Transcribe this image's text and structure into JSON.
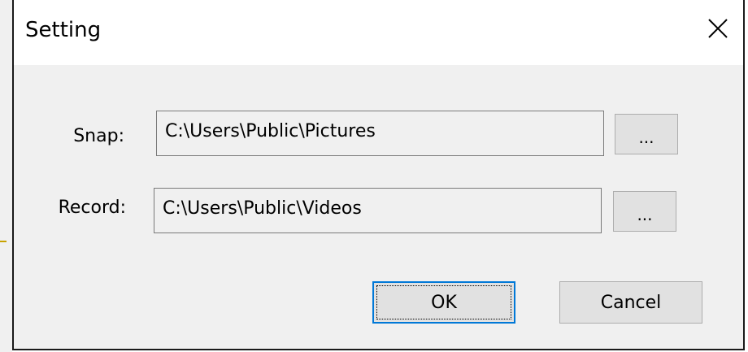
{
  "window": {
    "title": "Setting",
    "close_icon": "close-icon"
  },
  "fields": {
    "snap": {
      "label": "Snap:",
      "value": "C:\\Users\\Public\\Pictures",
      "browse_label": "..."
    },
    "record": {
      "label": "Record:",
      "value": "C:\\Users\\Public\\Videos",
      "browse_label": "..."
    }
  },
  "buttons": {
    "ok_label": "OK",
    "cancel_label": "Cancel"
  },
  "colors": {
    "dialog_bg": "#f0f0f0",
    "titlebar_bg": "#ffffff",
    "button_bg": "#e1e1e1",
    "focus_border": "#0078d7"
  }
}
